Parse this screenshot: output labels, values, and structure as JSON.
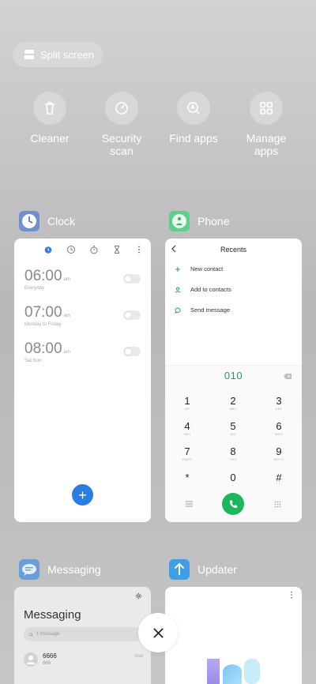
{
  "split_screen": {
    "label": "Split screen"
  },
  "tools": [
    {
      "label": "Cleaner",
      "icon": "trash-icon"
    },
    {
      "label": "Security\nscan",
      "icon": "gauge-icon"
    },
    {
      "label": "Find apps",
      "icon": "search-apps-icon"
    },
    {
      "label": "Manage\napps",
      "icon": "grid-icon"
    }
  ],
  "apps": {
    "clock": {
      "name": "Clock",
      "alarms": [
        {
          "time": "06:00",
          "ampm": "am",
          "repeat": "Everyday"
        },
        {
          "time": "07:00",
          "ampm": "am",
          "repeat": "Monday to Friday"
        },
        {
          "time": "08:00",
          "ampm": "am",
          "repeat": "Sat Sun"
        }
      ],
      "fab": "+"
    },
    "phone": {
      "name": "Phone",
      "title": "Recents",
      "actions": [
        "New contact",
        "Add to contacts",
        "Send message"
      ],
      "dialed": "010",
      "keys": [
        {
          "d": "1",
          "l": "GP"
        },
        {
          "d": "2",
          "l": "ABC"
        },
        {
          "d": "3",
          "l": "DEF"
        },
        {
          "d": "4",
          "l": "GHI"
        },
        {
          "d": "5",
          "l": "JKL"
        },
        {
          "d": "6",
          "l": "MNO"
        },
        {
          "d": "7",
          "l": "PQRS"
        },
        {
          "d": "8",
          "l": "TUV"
        },
        {
          "d": "9",
          "l": "WXYZ"
        },
        {
          "d": "*",
          "l": ""
        },
        {
          "d": "0",
          "l": "+"
        },
        {
          "d": "#",
          "l": ""
        }
      ]
    },
    "messaging": {
      "name": "Messaging",
      "title": "Messaging",
      "search_placeholder": "1 message",
      "contact": "6666",
      "preview": "666",
      "status": "Draft"
    },
    "updater": {
      "name": "Updater"
    }
  },
  "colors": {
    "accent_blue": "#2a7de1",
    "call_green": "#1db65a",
    "dialed_green": "#1aa15a"
  }
}
